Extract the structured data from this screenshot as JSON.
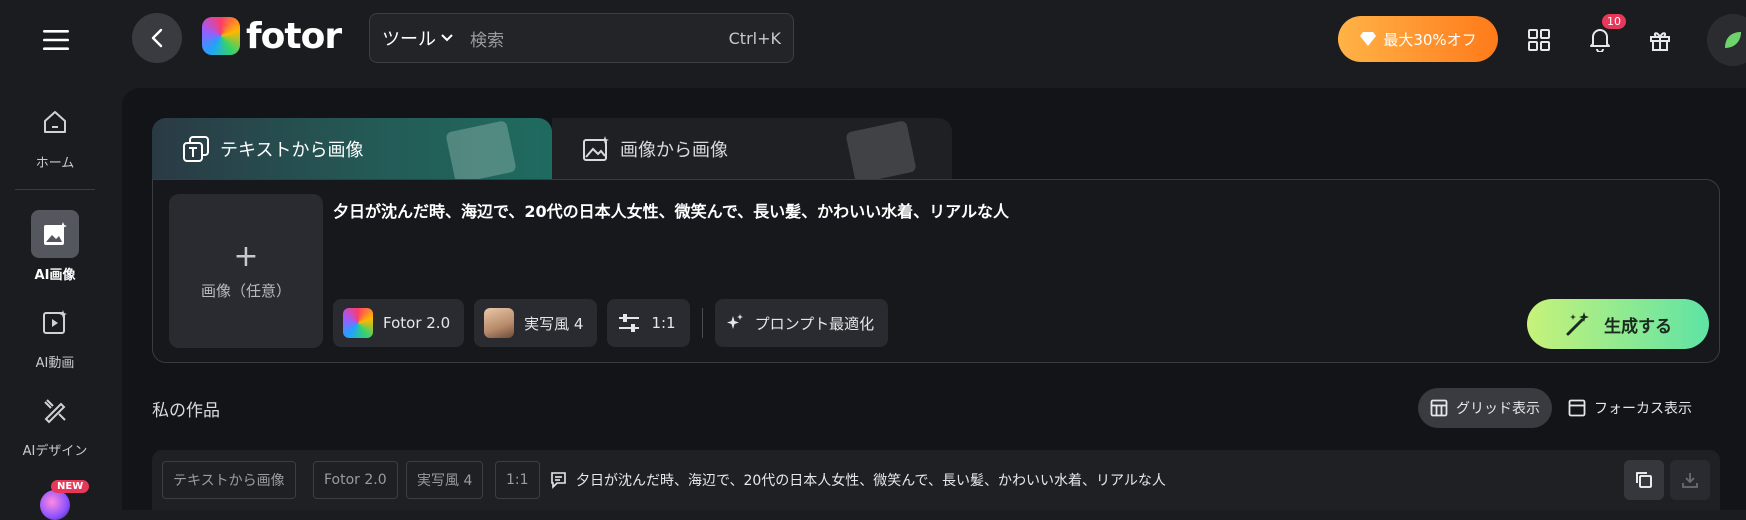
{
  "topbar": {
    "logo_text": "fotor",
    "search": {
      "tools_label": "ツール",
      "placeholder": "検索",
      "shortcut": "Ctrl+K"
    },
    "promo_label": "最大30%オフ",
    "notification_count": "10"
  },
  "sidebar": {
    "items": [
      {
        "label": "ホーム",
        "icon": "home-icon"
      },
      {
        "label": "AI画像",
        "icon": "ai-image-icon",
        "active": true
      },
      {
        "label": "AI動画",
        "icon": "ai-video-icon"
      },
      {
        "label": "AIデザイン",
        "icon": "ai-design-icon"
      }
    ],
    "new_badge": "NEW"
  },
  "tabs": [
    {
      "label": "テキストから画像",
      "active": true
    },
    {
      "label": "画像から画像",
      "active": false
    }
  ],
  "prompt": {
    "upload_label": "画像（任意）",
    "text": "夕日が沈んだ時、海辺で、20代の日本人女性、微笑んで、長い髪、かわいい水着、リアルな人",
    "chips": {
      "model": "Fotor 2.0",
      "style": "実写風 4",
      "ratio": "1:1",
      "optimize": "プロンプト最適化"
    },
    "generate_label": "生成する"
  },
  "works": {
    "title": "私の作品",
    "view_grid": "グリッド表示",
    "view_focus": "フォーカス表示",
    "row": {
      "tags": [
        "テキストから画像",
        "Fotor 2.0",
        "実写風 4",
        "1:1"
      ],
      "prompt": "夕日が沈んだ時、海辺で、20代の日本人女性、微笑んで、長い髪、かわいい水着、リアルな人"
    }
  },
  "colors": {
    "background": "#131417",
    "accent_generate_start": "#c7f27a",
    "accent_generate_end": "#5fe3a5",
    "promo_orange": "#ff7a1a",
    "badge_red": "#e8385a"
  }
}
